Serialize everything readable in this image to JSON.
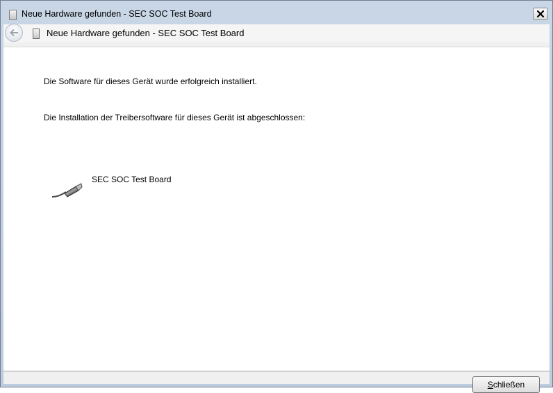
{
  "window": {
    "title": "Neue Hardware gefunden - SEC SOC Test Board",
    "close_icon": "close-icon",
    "device_icon": "usb-device-icon"
  },
  "nav": {
    "back_icon": "back-arrow-icon",
    "title": "Neue Hardware gefunden - SEC SOC Test Board"
  },
  "content": {
    "success_message": "Die Software für dieses Gerät wurde erfolgreich installiert.",
    "install_message": "Die Installation der Treibersoftware für dieses Gerät ist abgeschlossen:",
    "device_name": "SEC SOC Test Board",
    "device_icon": "usb-cable-icon"
  },
  "footer": {
    "close_button": {
      "mnemonic": "S",
      "rest": "chließen"
    }
  }
}
